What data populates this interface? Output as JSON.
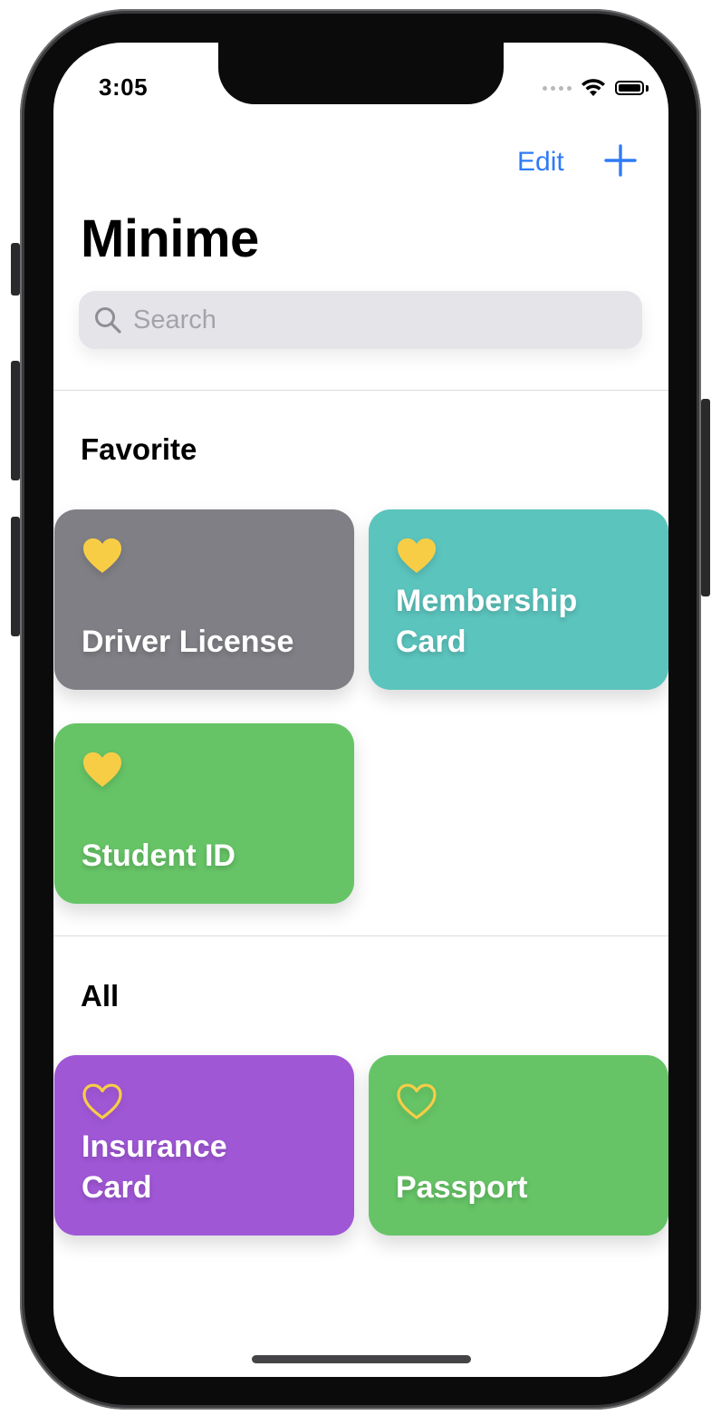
{
  "status_bar": {
    "time": "3:05"
  },
  "nav": {
    "edit_label": "Edit",
    "add_icon": "plus-icon"
  },
  "title": "Minime",
  "search": {
    "placeholder": "Search"
  },
  "sections": {
    "favorite": {
      "title": "Favorite",
      "cards": [
        {
          "label": "Driver License",
          "color": "#7f7f85",
          "favorite": true
        },
        {
          "label": "Membership\nCard",
          "color": "#5bc4bd",
          "favorite": true
        },
        {
          "label": "Student ID",
          "color": "#66c466",
          "favorite": true
        }
      ]
    },
    "all": {
      "title": "All",
      "cards": [
        {
          "label": "Insurance\nCard",
          "color": "#a057d6",
          "favorite": false
        },
        {
          "label": "Passport",
          "color": "#66c466",
          "favorite": false
        }
      ]
    }
  },
  "colors": {
    "accent": "#2f7bf6",
    "heart": "#f8cd46"
  }
}
